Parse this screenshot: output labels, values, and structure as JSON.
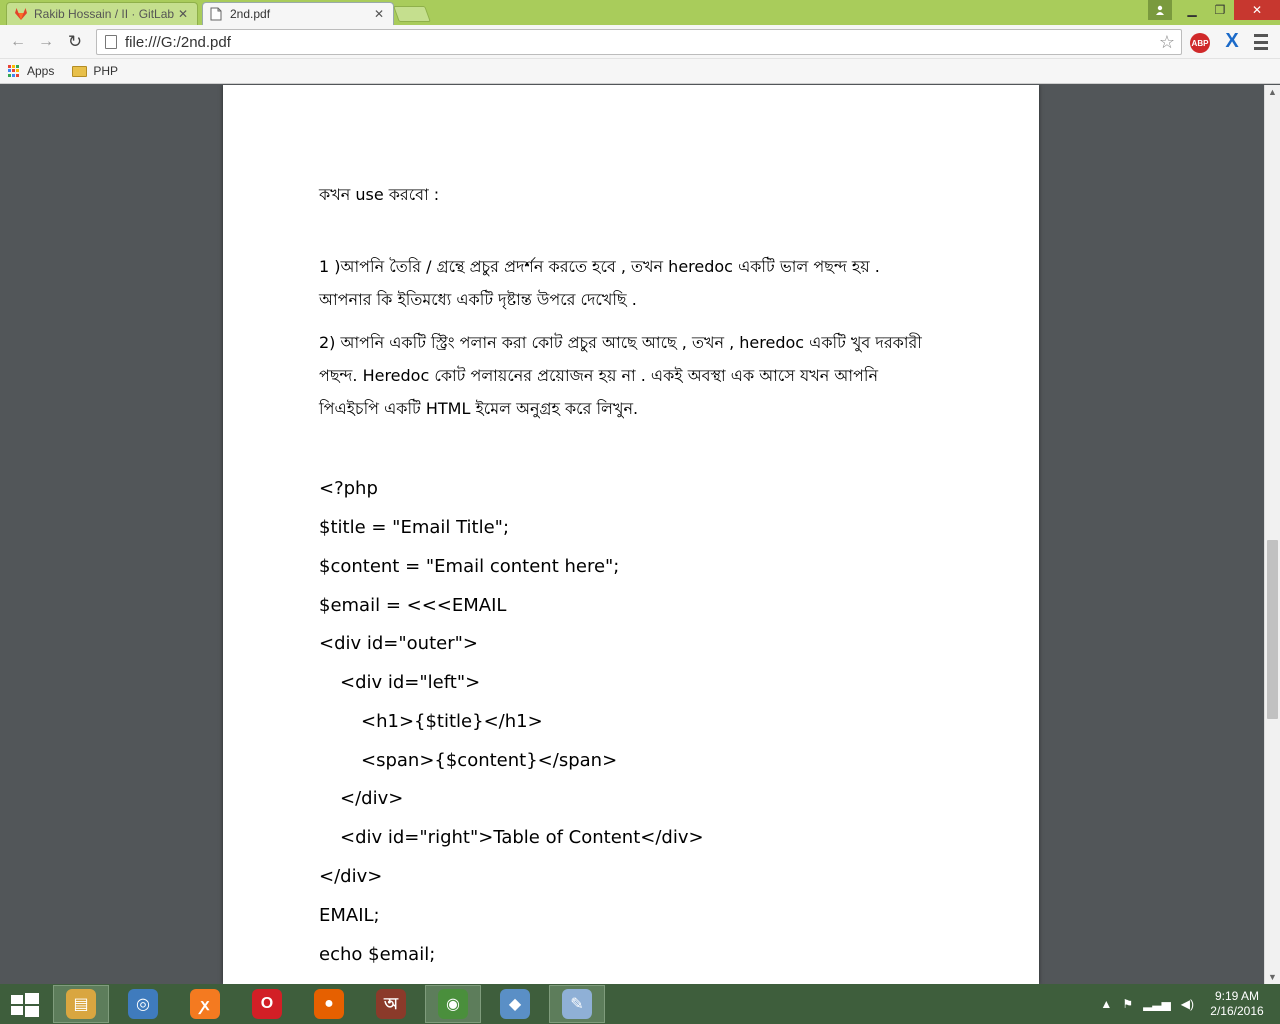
{
  "browser": {
    "tabs": [
      {
        "title": "Rakib Hossain / II · GitLab",
        "active": false,
        "icon": "gitlab-icon"
      },
      {
        "title": "2nd.pdf",
        "active": true,
        "icon": "document-icon"
      }
    ],
    "address": "file:///G:/2nd.pdf",
    "extensions": {
      "abp": "ABP",
      "x": "X"
    },
    "bookmarks": [
      {
        "label": "Apps",
        "icon": "apps-grid-icon"
      },
      {
        "label": "PHP",
        "icon": "folder-icon"
      }
    ]
  },
  "document": {
    "heading": "কখন use করবো :",
    "para1_line1": "1 )আপনি তৈরি / গ্রন্থে প্রচুর প্রদর্শন করতে হবে , তখন heredoc একটি ভাল পছন্দ হয় .",
    "para1_line2": "আপনার কি ইতিমধ্যে একটি দৃষ্টান্ত উপরে দেখেছি .",
    "para2_line1": "2) আপনি একটি স্ট্রিং পলান করা কোট প্রচুর আছে আছে , তখন , heredoc একটি খুব দরকারী",
    "para2_line2": "পছন্দ. Heredoc কোট পলায়নের প্রয়োজন হয় না . একই অবস্থা এক আসে যখন আপনি",
    "para2_line3": "পিএইচপি একটি HTML ইমেল অনুগ্রহ করে লিখুন.",
    "code": [
      "<?php",
      "$title = \"Email Title\";",
      "$content = \"Email content here\";",
      "$email = <<<EMAIL",
      "<div id=\"outer\">",
      "<div id=\"left\">",
      "<h1>{$title}</h1>",
      "<span>{$content}</span>",
      "</div>",
      "<div id=\"right\">Table of Content</div>",
      "</div>",
      "EMAIL;",
      "echo $email;"
    ]
  },
  "taskbar": {
    "items": [
      {
        "name": "file-explorer-icon",
        "color": "#d9a640",
        "glyph": "▤"
      },
      {
        "name": "safari-icon",
        "color": "#3f7bbd",
        "glyph": "◎"
      },
      {
        "name": "xampp-icon",
        "color": "#f47a20",
        "glyph": "ꭗ"
      },
      {
        "name": "opera-icon",
        "color": "#d21f26",
        "glyph": "O"
      },
      {
        "name": "firefox-icon",
        "color": "#e66000",
        "glyph": "●"
      },
      {
        "name": "bangla-app-icon",
        "color": "#8b3a2a",
        "glyph": "অ"
      },
      {
        "name": "chrome-icon",
        "color": "#4a8f3c",
        "glyph": "◉"
      },
      {
        "name": "virtualbox-icon",
        "color": "#5a8fc6",
        "glyph": "◆"
      },
      {
        "name": "paint-icon",
        "color": "#8fb0d6",
        "glyph": "✎"
      }
    ],
    "time": "9:19 AM",
    "date": "2/16/2016"
  }
}
